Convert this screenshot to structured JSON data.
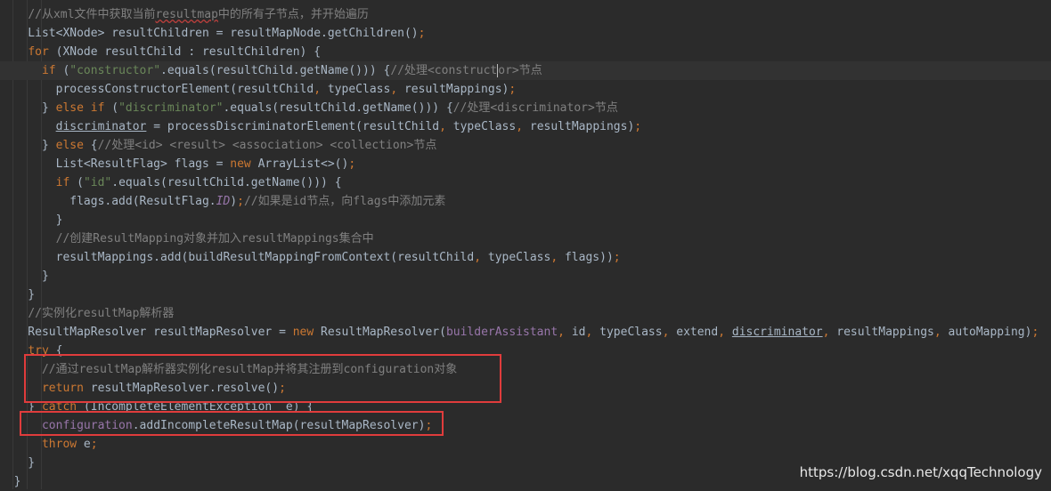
{
  "code_lines": [
    [
      {
        "t": "    ",
        "c": ""
      },
      {
        "t": "//从xml文件中获取当前",
        "c": "cm"
      },
      {
        "t": "resultmap",
        "c": "cm sq"
      },
      {
        "t": "中的所有子节点，并开始遍历",
        "c": "cm"
      }
    ],
    [
      {
        "t": "    List<XNode> resultChildren = resultMapNode.getChildren()",
        "c": ""
      },
      {
        "t": ";",
        "c": "kw"
      }
    ],
    [
      {
        "t": "    ",
        "c": ""
      },
      {
        "t": "for",
        "c": "kw"
      },
      {
        "t": " (XNode resultChild : resultChildren) {",
        "c": ""
      }
    ],
    [
      {
        "t": "      ",
        "c": ""
      },
      {
        "t": "if",
        "c": "kw"
      },
      {
        "t": " (",
        "c": ""
      },
      {
        "t": "\"constructor\"",
        "c": "str"
      },
      {
        "t": ".equals(resultChild.getName())) {",
        "c": ""
      },
      {
        "t": "//处理",
        "c": "cm"
      },
      {
        "t": "<construct",
        "c": "cm"
      },
      {
        "t": "",
        "c": "caret"
      },
      {
        "t": "or>",
        "c": "cm"
      },
      {
        "t": "节点",
        "c": "cm"
      }
    ],
    [
      {
        "t": "        processConstructorElement(resultChild",
        "c": ""
      },
      {
        "t": ",",
        "c": "kw"
      },
      {
        "t": " typeClass",
        "c": ""
      },
      {
        "t": ",",
        "c": "kw"
      },
      {
        "t": " resultMappings)",
        "c": ""
      },
      {
        "t": ";",
        "c": "kw"
      }
    ],
    [
      {
        "t": "      } ",
        "c": ""
      },
      {
        "t": "else if",
        "c": "kw"
      },
      {
        "t": " (",
        "c": ""
      },
      {
        "t": "\"discriminator\"",
        "c": "str"
      },
      {
        "t": ".equals(resultChild.getName())) {",
        "c": ""
      },
      {
        "t": "//处理<discriminator>节点",
        "c": "cm"
      }
    ],
    [
      {
        "t": "        ",
        "c": ""
      },
      {
        "t": "discriminator",
        "c": "ul"
      },
      {
        "t": " = processDiscriminatorElement(resultChild",
        "c": ""
      },
      {
        "t": ",",
        "c": "kw"
      },
      {
        "t": " typeClass",
        "c": ""
      },
      {
        "t": ",",
        "c": "kw"
      },
      {
        "t": " resultMappings)",
        "c": ""
      },
      {
        "t": ";",
        "c": "kw"
      }
    ],
    [
      {
        "t": "      } ",
        "c": ""
      },
      {
        "t": "else",
        "c": "kw"
      },
      {
        "t": " {",
        "c": ""
      },
      {
        "t": "//处理<id> <result> <association> <collection>节点",
        "c": "cm"
      }
    ],
    [
      {
        "t": "        List<ResultFlag> flags = ",
        "c": ""
      },
      {
        "t": "new",
        "c": "kw"
      },
      {
        "t": " ArrayList<>()",
        "c": ""
      },
      {
        "t": ";",
        "c": "kw"
      }
    ],
    [
      {
        "t": "        ",
        "c": ""
      },
      {
        "t": "if",
        "c": "kw"
      },
      {
        "t": " (",
        "c": ""
      },
      {
        "t": "\"id\"",
        "c": "str"
      },
      {
        "t": ".equals(resultChild.getName())) {",
        "c": ""
      }
    ],
    [
      {
        "t": "          flags.add(ResultFlag.",
        "c": ""
      },
      {
        "t": "ID",
        "c": "fldi"
      },
      {
        "t": ")",
        "c": ""
      },
      {
        "t": ";",
        "c": "kw"
      },
      {
        "t": "//如果是id节点，向flags中添加元素",
        "c": "cm"
      }
    ],
    [
      {
        "t": "        }",
        "c": ""
      }
    ],
    [
      {
        "t": "        ",
        "c": ""
      },
      {
        "t": "//创建ResultMapping对象并加入resultMappings集合中",
        "c": "cm"
      }
    ],
    [
      {
        "t": "        resultMappings.add(buildResultMappingFromContext(resultChild",
        "c": ""
      },
      {
        "t": ",",
        "c": "kw"
      },
      {
        "t": " typeClass",
        "c": ""
      },
      {
        "t": ",",
        "c": "kw"
      },
      {
        "t": " flags))",
        "c": ""
      },
      {
        "t": ";",
        "c": "kw"
      }
    ],
    [
      {
        "t": "      }",
        "c": ""
      }
    ],
    [
      {
        "t": "    }",
        "c": ""
      }
    ],
    [
      {
        "t": "    ",
        "c": ""
      },
      {
        "t": "//实例化resultMap解析器",
        "c": "cm"
      }
    ],
    [
      {
        "t": "    ResultMapResolver resultMapResolver = ",
        "c": ""
      },
      {
        "t": "new",
        "c": "kw"
      },
      {
        "t": " ResultMapResolver(",
        "c": ""
      },
      {
        "t": "builderAssistant",
        "c": "fld"
      },
      {
        "t": ",",
        "c": "kw"
      },
      {
        "t": " id",
        "c": ""
      },
      {
        "t": ",",
        "c": "kw"
      },
      {
        "t": " typeClass",
        "c": ""
      },
      {
        "t": ",",
        "c": "kw"
      },
      {
        "t": " extend",
        "c": ""
      },
      {
        "t": ",",
        "c": "kw"
      },
      {
        "t": " ",
        "c": ""
      },
      {
        "t": "discriminator",
        "c": "ul"
      },
      {
        "t": ",",
        "c": "kw"
      },
      {
        "t": " resultMappings",
        "c": ""
      },
      {
        "t": ",",
        "c": "kw"
      },
      {
        "t": " autoMapping)",
        "c": ""
      },
      {
        "t": ";",
        "c": "kw"
      }
    ],
    [
      {
        "t": "    ",
        "c": ""
      },
      {
        "t": "try",
        "c": "kw"
      },
      {
        "t": " {",
        "c": ""
      }
    ],
    [
      {
        "t": "      ",
        "c": ""
      },
      {
        "t": "//通过resultMap解析器实例化resultMap并将其注册到configuration对象",
        "c": "cm"
      }
    ],
    [
      {
        "t": "      ",
        "c": ""
      },
      {
        "t": "return",
        "c": "kw"
      },
      {
        "t": " resultMapResolver.resolve()",
        "c": ""
      },
      {
        "t": ";",
        "c": "kw"
      }
    ],
    [
      {
        "t": "    } ",
        "c": ""
      },
      {
        "t": "catch",
        "c": "kw"
      },
      {
        "t": " (IncompleteElementException  e) {",
        "c": ""
      }
    ],
    [
      {
        "t": "      ",
        "c": ""
      },
      {
        "t": "configuration",
        "c": "fld"
      },
      {
        "t": ".addIncompleteResultMap(resultMapResolver)",
        "c": ""
      },
      {
        "t": ";",
        "c": "kw"
      }
    ],
    [
      {
        "t": "      ",
        "c": ""
      },
      {
        "t": "throw",
        "c": "kw"
      },
      {
        "t": " e",
        "c": ""
      },
      {
        "t": ";",
        "c": "kw"
      }
    ],
    [
      {
        "t": "    }",
        "c": ""
      }
    ],
    [
      {
        "t": "  }",
        "c": ""
      }
    ]
  ],
  "watermark": "https://blog.csdn.net/xqqTechnology",
  "colors": {
    "background": "#2b2b2b",
    "text": "#a9b7c6",
    "keyword": "#cc7832",
    "string": "#6a8759",
    "comment": "#808080",
    "field": "#9876aa",
    "highlight_box": "#e03c3c"
  }
}
